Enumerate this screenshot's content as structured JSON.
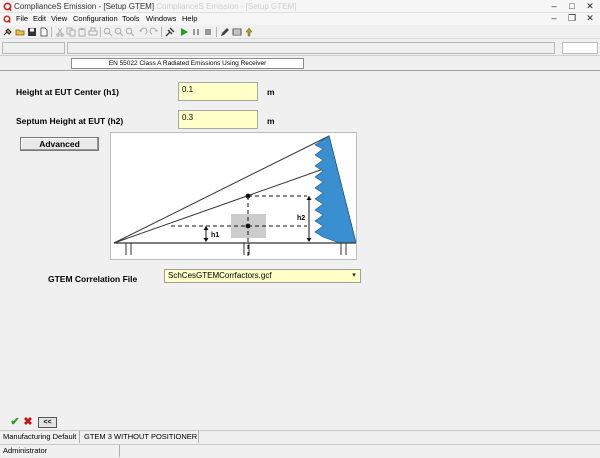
{
  "window": {
    "title": "ComplianceS Emission - [Setup GTEM]",
    "ghost_title": "ComplianceS Emission - [Setup GTEM]",
    "minimize": "–",
    "maximize": "□",
    "close": "✕",
    "mdi_minimize": "–",
    "mdi_restore": "❐",
    "mdi_close": "✕"
  },
  "menu": [
    "File",
    "Edit",
    "View",
    "Configuration",
    "Tools",
    "Windows",
    "Help"
  ],
  "toolbar": {
    "icons": [
      "connect-icon",
      "open-folder-icon",
      "save-icon",
      "new-document-icon",
      "cut-icon",
      "copy-icon",
      "paste-icon",
      "print-icon",
      "zoom-in-icon",
      "zoom-out-icon",
      "zoom-fit-icon",
      "undo-icon",
      "redo-icon",
      "tools-icon",
      "run-icon",
      "pause-icon",
      "stop-icon",
      "edit-icon",
      "table-icon",
      "arrow-up-icon"
    ],
    "stop_color": "#333333",
    "run_color": "#1fa31f"
  },
  "test_title": "EN 55022 Class A Radiated Emissions Using Receiver",
  "form": {
    "h1_label": "Height at EUT Center (h1)",
    "h1_value": "0.1",
    "h1_unit": "m",
    "h2_label": "Septum Height at EUT (h2)",
    "h2_value": "0.3",
    "h2_unit": "m",
    "advanced_label": "Advanced",
    "correlation_label": "GTEM Correlation File",
    "correlation_value": "SchCesGTEMCorrfactors.gcf",
    "field_color": "#ffffc8"
  },
  "diagram": {
    "h1_text": "h1",
    "h2_text": "h2",
    "absorber_color": "#3a8fd0"
  },
  "bottom": {
    "ok_glyph": "✔",
    "cancel_glyph": "✖",
    "back_label": "<<",
    "ok_color": "#2a9a2a",
    "cancel_color": "#c01818"
  },
  "status": {
    "cell1": "Manufacturing Default",
    "cell2": "GTEM 3 WITHOUT POSITIONER",
    "user": "Administrator"
  }
}
